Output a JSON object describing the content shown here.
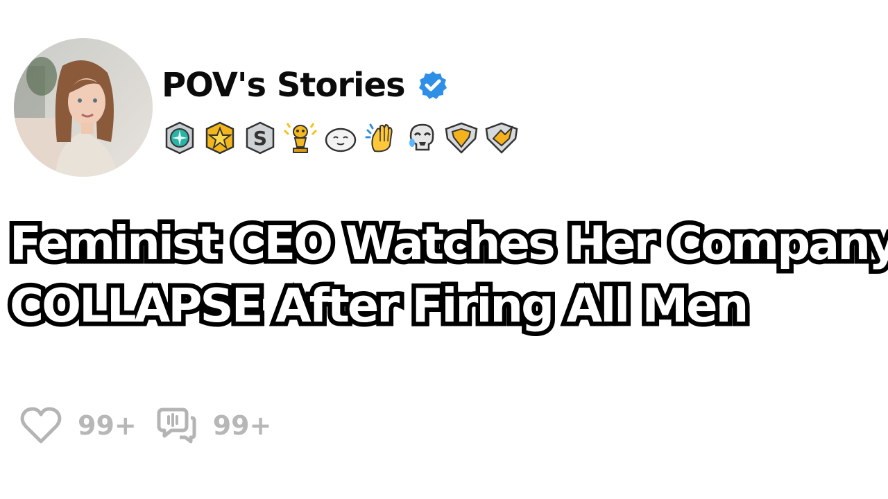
{
  "post": {
    "channel_name": "POV's Stories",
    "verified_icon": "verified-check-icon",
    "avatar": "profile-photo",
    "badges": [
      "teal-medal-icon",
      "gold-star-badge-icon",
      "silver-s-badge-icon",
      "golden-trophy-icon",
      "white-blob-face-icon",
      "clapping-hands-icon",
      "laughing-skull-icon",
      "gold-heart-chevron-badge-icon",
      "gold-chevron-wing-badge-icon"
    ],
    "headline_lines": [
      "Feminist CEO Watches Her Company",
      "COLLAPSE After Firing All Men"
    ],
    "likes": "99+",
    "comments": "99+"
  },
  "colors": {
    "background": "#ffffff",
    "verified_blue": "#2f8fe6",
    "stat_gray": "#b5b5b5",
    "headline_fill": "#ffffff",
    "headline_stroke": "#000000"
  }
}
